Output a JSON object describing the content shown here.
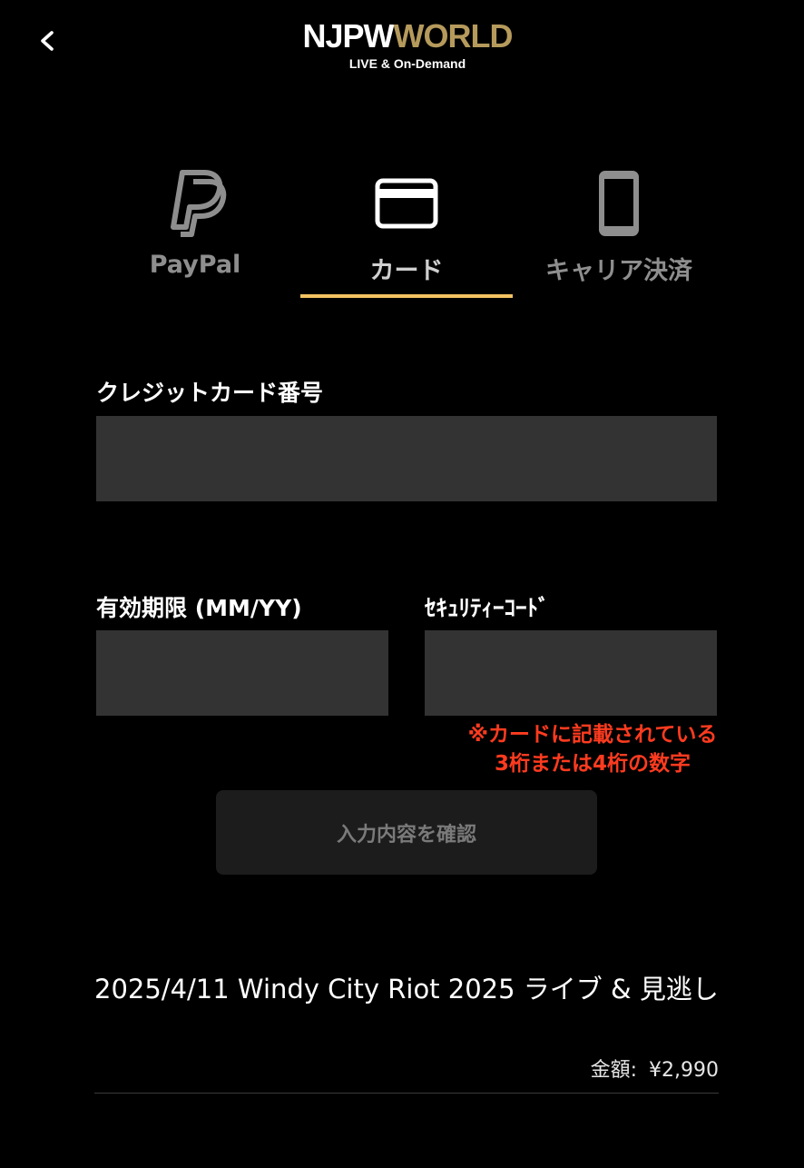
{
  "header": {
    "back_icon": "chevron-left-icon",
    "logo_part1": "NJPW",
    "logo_part2": "WORLD",
    "logo_tagline": "LIVE & On-Demand"
  },
  "tabs": [
    {
      "label": "PayPal",
      "icon": "paypal-icon",
      "active": false
    },
    {
      "label": "カード",
      "icon": "credit-card-icon",
      "active": true
    },
    {
      "label": "キャリア決済",
      "icon": "smartphone-icon",
      "active": false
    }
  ],
  "form": {
    "card_number_label": "クレジットカード番号",
    "card_number_value": "",
    "expiry_label": "有効期限 (MM/YY)",
    "expiry_value": "",
    "security_label": "ｾｷｭﾘﾃｨｰｺｰﾄﾞ",
    "security_value": "",
    "security_note_line1": "※カードに記載されている",
    "security_note_line2": "3桁または4桁の数字",
    "confirm_label": "入力内容を確認"
  },
  "order": {
    "product_title": "2025/4/11 Windy City Riot 2025 ライブ & 見逃し",
    "price_label": "金額:",
    "price_value": "¥2,990"
  },
  "colors": {
    "background": "#000000",
    "accent_underline": "#f2c261",
    "logo_gold": "#b59a5c",
    "input_bg": "#333333",
    "note_red": "#ff3b1f",
    "button_bg": "#1c1c1c"
  }
}
